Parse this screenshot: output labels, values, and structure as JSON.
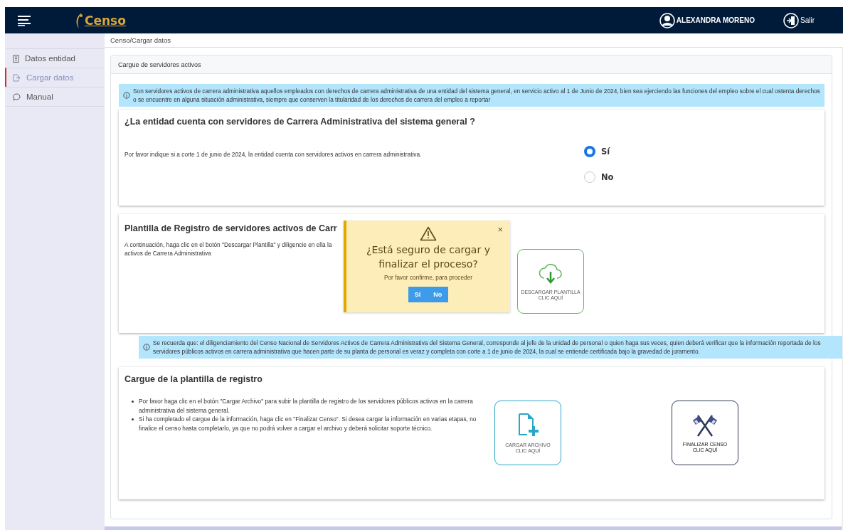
{
  "navbar": {
    "logo_text": "Censo",
    "user": "ALEXANDRA MORENO",
    "logout": "Salir"
  },
  "sidebar": {
    "items": [
      {
        "label": "Datos entidad",
        "kind": "building",
        "selected": false
      },
      {
        "label": "Cargar datos",
        "kind": "upload",
        "selected": true
      },
      {
        "label": "Manual",
        "kind": "chat",
        "selected": false
      }
    ]
  },
  "breadcrumb": "Censo/Cargar datos",
  "card_title": "Cargue de servidores activos",
  "info_alert": "Son servidores activos de carrera administrativa aquellos empleados con derechos de carrera administrativa de una entidad del sistema general, en servicio activo al 1 de Junio de 2024, bien sea ejerciendo las funciones del empleo sobre el cual ostenta derechos o se encuentre en alguna situación administrativa, siempre que conserven la titularidad de los derechos de carrera del empleo a reportar",
  "question": {
    "title": "¿La entidad cuenta con servidores de Carrera Administrativa del sistema general ?",
    "text": "Por favor indique si a corte 1 de junio de 2024, la entidad cuenta con servidores activos en carrera administrativa.",
    "options": [
      {
        "label": "Sí",
        "selected": true
      },
      {
        "label": "No",
        "selected": false
      }
    ]
  },
  "template": {
    "title": "Plantilla de Registro de servidores activos de Carr",
    "text_1": "A continuación, haga clic en el botón \"Descargar Plantilla\" y diligencie en ella la",
    "text_2": "activos de Carrera Administrativa",
    "button": [
      "DESCARGAR PLANTILLA",
      "CLIC AQUÍ"
    ]
  },
  "reminder_alert": "Se recuerda que: el diligenciamiento del Censo Nacional de Servidores Activos de Carrera Administrativa del Sistema General, corresponde al jefe de la unidad de personal o quien haga sus veces, quien deberá verificar que la información reportada de los servidores públicos activos en carrera administrativa que hacen parte de su planta de personal es veraz y completa con corte a 1 de junio de 2024, la cual se entiende certificada bajo la gravedad de juramento.",
  "upload": {
    "title": "Cargue de la plantilla de registro",
    "bullets": [
      "Por favor haga clic en el botón \"Cargar Archivo\" para subir la plantilla de registro de los servidores públicos activos en la carrera administrativa del sistema general.",
      "Si ha completado el cargue de la información, haga clic en \"Finalizar Censo\". Si desea cargar la información en varias etapas, no finalice el censo hasta completarlo, ya que no podrá volver a cargar el archivo y deberá solicitar soporte técnico."
    ],
    "buttons": [
      {
        "kind": "upload",
        "lines": [
          "CARGAR ARCHIVO",
          "CLIC AQUÍ"
        ]
      },
      {
        "kind": "finish",
        "lines": [
          "FINALIZAR CENSO",
          "CLIC AQUÍ"
        ]
      }
    ]
  },
  "toast": {
    "title": "¿Está seguro de cargar y finalizar el proceso?",
    "text": "Por favor confirme, para proceder",
    "close": "×",
    "buttons": [
      "Sí",
      "No"
    ]
  }
}
